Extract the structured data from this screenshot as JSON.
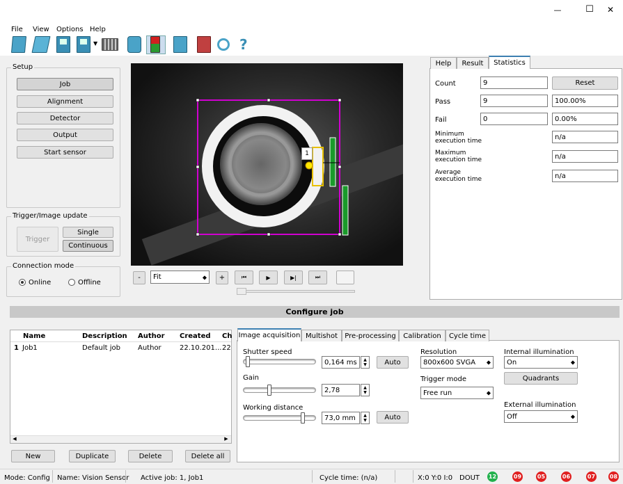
{
  "window": {
    "minimize_glyph": "—",
    "maximize_glyph": "☐",
    "close_glyph": "✕"
  },
  "menu": [
    "File",
    "View",
    "Options",
    "Help"
  ],
  "toolbar_icons": [
    "new-icon",
    "open-icon",
    "save-icon",
    "save-as-icon",
    "film-icon",
    "camera-icon",
    "config-mode-icon",
    "image-icon",
    "record-icon",
    "zoom-icon",
    "help-icon"
  ],
  "setup": {
    "title": "Setup",
    "buttons": [
      "Job",
      "Alignment",
      "Detector",
      "Output",
      "Start sensor"
    ]
  },
  "trigger": {
    "title": "Trigger/Image update",
    "trigger_label": "Trigger",
    "single_label": "Single",
    "continuous_label": "Continuous"
  },
  "connection": {
    "title": "Connection mode",
    "online_label": "Online",
    "offline_label": "Offline"
  },
  "image_controls": {
    "minus": "-",
    "fit_value": "Fit",
    "plus": "+",
    "first": "⏮",
    "play": "▶",
    "next": "▶|",
    "last": "⏭"
  },
  "roi": {
    "label": "1"
  },
  "stats": {
    "tabs": [
      "Help",
      "Result",
      "Statistics"
    ],
    "count_label": "Count",
    "count_value": "9",
    "reset_label": "Reset",
    "pass_label": "Pass",
    "pass_value": "9",
    "pass_pct": "100.00%",
    "fail_label": "Fail",
    "fail_value": "0",
    "fail_pct": "0.00%",
    "min_label": "Minimum\nexecution time",
    "min_value": "n/a",
    "max_label": "Maximum\nexecution time",
    "max_value": "n/a",
    "avg_label": "Average\nexecution time",
    "avg_value": "n/a"
  },
  "configure_title": "Configure job",
  "jobs_table": {
    "headers": [
      "Name",
      "Description",
      "Author",
      "Created",
      "Ch"
    ],
    "rows": [
      {
        "num": "1",
        "name": "Job1",
        "description": "Default job",
        "author": "Author",
        "created": "22.10.201...",
        "ch": "22."
      }
    ]
  },
  "job_buttons": {
    "new": "New",
    "duplicate": "Duplicate",
    "delete": "Delete",
    "delete_all": "Delete all"
  },
  "config_tabs": [
    "Image acquisition",
    "Multishot",
    "Pre-processing",
    "Calibration",
    "Cycle time"
  ],
  "acq": {
    "shutter_label": "Shutter speed",
    "shutter_value": "0,164 ms",
    "shutter_level": 0.02,
    "auto1": "Auto",
    "gain_label": "Gain",
    "gain_value": "2,78",
    "gain_level": 0.35,
    "wd_label": "Working distance",
    "wd_value": "73,0 mm",
    "wd_level": 0.85,
    "auto2": "Auto",
    "resolution_label": "Resolution",
    "resolution_value": "800x600 SVGA",
    "trigger_mode_label": "Trigger mode",
    "trigger_mode_value": "Free run",
    "int_illum_label": "Internal illumination",
    "int_illum_value": "On",
    "quadrants_label": "Quadrants",
    "ext_illum_label": "External illumination",
    "ext_illum_value": "Off"
  },
  "status": {
    "mode": "Mode:  Config",
    "name": "Name:  Vision Sensor",
    "active_job": "Active job:  1, Job1",
    "cycle_time": "Cycle time:  (n/a)",
    "xyi": "X:0 Y:0 I:0",
    "dout": "DOUT",
    "leds": [
      {
        "label": "12",
        "color": "#22b14c"
      },
      {
        "label": "09",
        "color": "#e02020"
      },
      {
        "label": "05",
        "color": "#e02020"
      },
      {
        "label": "06",
        "color": "#e02020"
      },
      {
        "label": "07",
        "color": "#e02020"
      },
      {
        "label": "08",
        "color": "#e02020"
      }
    ]
  }
}
